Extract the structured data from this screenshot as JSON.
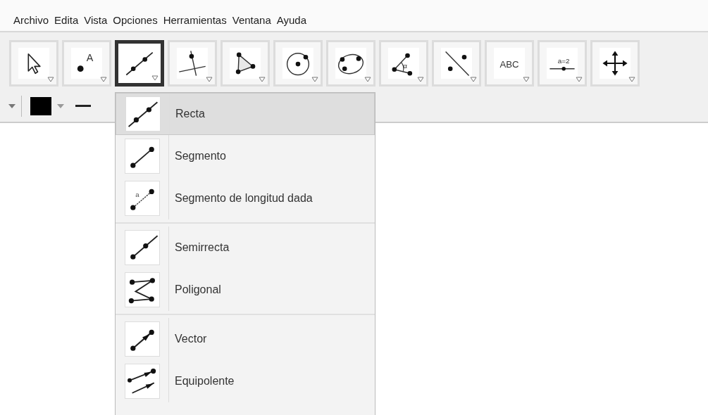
{
  "menu_bar": [
    "Archivo",
    "Edita",
    "Vista",
    "Opciones",
    "Herramientas",
    "Ventana",
    "Ayuda"
  ],
  "toolbar": [
    {
      "kind": "pointer",
      "selected": false
    },
    {
      "kind": "point",
      "label": "A",
      "selected": false
    },
    {
      "kind": "line",
      "selected": true
    },
    {
      "kind": "perpendicular",
      "selected": false
    },
    {
      "kind": "polygon",
      "selected": false
    },
    {
      "kind": "circle",
      "selected": false
    },
    {
      "kind": "conic",
      "selected": false
    },
    {
      "kind": "angle",
      "label": "α",
      "selected": false
    },
    {
      "kind": "reflect",
      "selected": false
    },
    {
      "kind": "text",
      "label": "ABC",
      "selected": false
    },
    {
      "kind": "slider",
      "label": "a=2",
      "selected": false
    },
    {
      "kind": "move",
      "selected": false
    }
  ],
  "style_bar": {
    "color": "#000000"
  },
  "dropdown": {
    "groups": [
      {
        "items": [
          {
            "kind": "line",
            "label": "Recta",
            "selected": true
          },
          {
            "kind": "segment",
            "label": "Segmento",
            "selected": false
          },
          {
            "kind": "segment-length",
            "icon_label": "a",
            "label": "Segmento de longitud dada",
            "selected": false
          }
        ]
      },
      {
        "items": [
          {
            "kind": "ray",
            "label": "Semirrecta",
            "selected": false
          },
          {
            "kind": "polyline",
            "label": "Poligonal",
            "selected": false
          }
        ]
      },
      {
        "items": [
          {
            "kind": "vector",
            "label": "Vector",
            "selected": false
          },
          {
            "kind": "vector-from-point",
            "label": "Equipolente",
            "selected": false
          }
        ]
      }
    ]
  }
}
